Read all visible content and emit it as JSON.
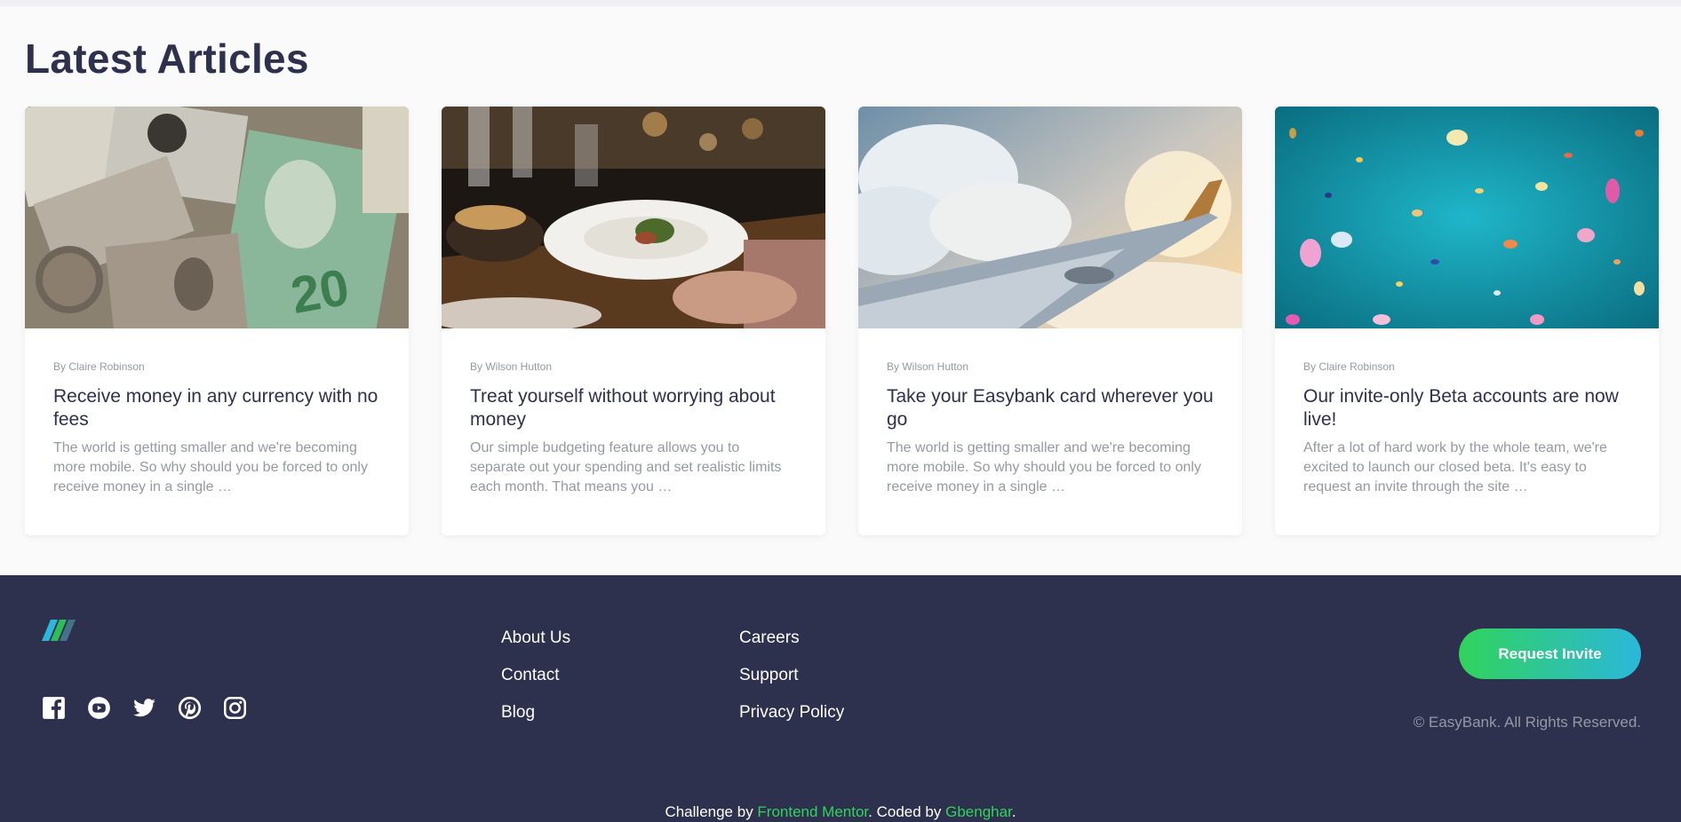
{
  "articles": {
    "heading": "Latest Articles",
    "cards": [
      {
        "author": "By Claire Robinson",
        "title": "Receive money in any currency with no fees",
        "excerpt": "The world is getting smaller and we're becoming more mobile. So why should you be forced to only receive money in a single …",
        "image": "currency-notes"
      },
      {
        "author": "By Wilson Hutton",
        "title": "Treat yourself without worrying about money",
        "excerpt": "Our simple budgeting feature allows you to separate out your spending and set realistic limits each month. That means you …",
        "image": "restaurant-dinner"
      },
      {
        "author": "By Wilson Hutton",
        "title": "Take your Easybank card wherever you go",
        "excerpt": "The world is getting smaller and we're becoming more mobile. So why should you be forced to only receive money in a single …",
        "image": "airplane-wing"
      },
      {
        "author": "By Claire Robinson",
        "title": "Our invite-only Beta accounts are now live!",
        "excerpt": "After a lot of hard work by the whole team, we're excited to launch our closed beta. It's easy to request an invite through the site …",
        "image": "confetti"
      }
    ]
  },
  "footer": {
    "logo_icon": "easybank-logo-icon",
    "social_icons": [
      "facebook-icon",
      "youtube-icon",
      "twitter-icon",
      "pinterest-icon",
      "instagram-icon"
    ],
    "links_col1": [
      "About Us",
      "Contact",
      "Blog"
    ],
    "links_col2": [
      "Careers",
      "Support",
      "Privacy Policy"
    ],
    "cta_label": "Request Invite",
    "copyright": "© EasyBank. All Rights Reserved.",
    "attribution": {
      "prefix": "Challenge by ",
      "link1": "Frontend Mentor",
      "middle": ". Coded by ",
      "link2": "Gbenghar",
      "suffix": "."
    }
  },
  "colors": {
    "dark_blue": "#2d314d",
    "lime_green": "#31d35c",
    "bright_cyan": "#2bb7da",
    "grayish_blue": "#9698a6"
  }
}
